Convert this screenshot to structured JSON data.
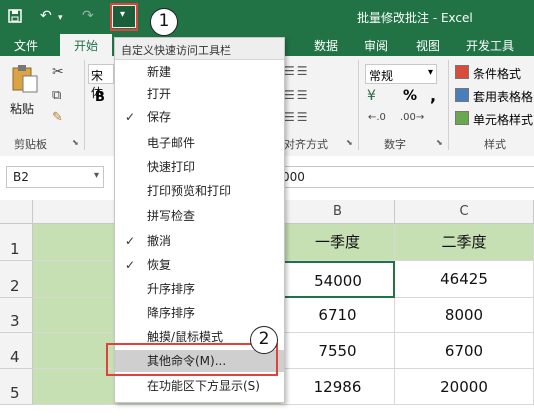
{
  "window": {
    "title": "批量修改批注 - Excel"
  },
  "qat": {
    "save_icon": "save-icon",
    "undo_icon": "undo-icon",
    "redo_icon": "redo-icon",
    "dropdown_icon": "customize-qat-dropdown-icon"
  },
  "tabs": [
    "文件",
    "开始",
    "数据",
    "审阅",
    "视图",
    "开发工具"
  ],
  "ribbon": {
    "clipboard": {
      "paste_label": "粘贴",
      "group_label": "剪贴板"
    },
    "font": {
      "font_box_fragment": "宋体",
      "bold": "B"
    },
    "alignment": {
      "group_label": "对齐方式"
    },
    "number": {
      "format_value": "常规",
      "percent": "%",
      "comma": ",",
      "currency": "¥",
      "group_label": "数字"
    },
    "styles": {
      "items": [
        "条件格式",
        "套用表格格",
        "单元格样式"
      ],
      "group_label": "样式"
    }
  },
  "name_box": {
    "value": "B2"
  },
  "formula_bar": {
    "value_fragment": "000"
  },
  "menu": {
    "header": "自定义快速访问工具栏",
    "items": [
      {
        "label": "新建",
        "checked": false
      },
      {
        "label": "打开",
        "checked": false
      },
      {
        "label": "保存",
        "checked": true
      },
      {
        "label": "电子邮件",
        "checked": false
      },
      {
        "label": "快速打印",
        "checked": false
      },
      {
        "label": "打印预览和打印",
        "checked": false
      },
      {
        "label": "拼写检查",
        "checked": false
      },
      {
        "label": "撤消",
        "checked": true
      },
      {
        "label": "恢复",
        "checked": true
      },
      {
        "label": "升序排序",
        "checked": false
      },
      {
        "label": "降序排序",
        "checked": false
      },
      {
        "label": "触摸/鼠标模式",
        "checked": false
      },
      {
        "label": "其他命令(M)...",
        "checked": false
      },
      {
        "label": "在功能区下方显示(S)",
        "checked": false
      }
    ]
  },
  "sheet": {
    "columns": [
      "B",
      "C"
    ],
    "rows": [
      "1",
      "2",
      "3",
      "4",
      "5"
    ],
    "header_row": [
      "一季度",
      "二季度"
    ],
    "data": [
      [
        "54000",
        "46425"
      ],
      [
        "6710",
        "8000"
      ],
      [
        "7550",
        "6700"
      ],
      [
        "12986",
        "20000"
      ]
    ]
  },
  "annotations": {
    "step1": "1",
    "step2": "2"
  },
  "colors": {
    "excel_green": "#217346",
    "header_fill": "#c6e0b4",
    "annotation_red": "#e0413d"
  }
}
